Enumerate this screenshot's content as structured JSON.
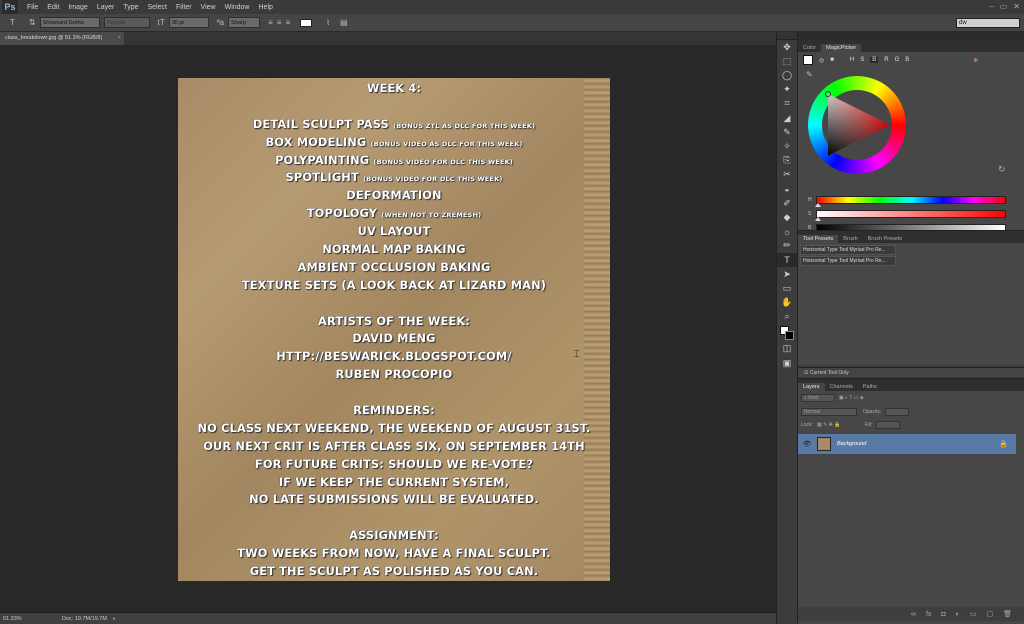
{
  "app": {
    "logo": "Ps"
  },
  "menu": [
    "File",
    "Edit",
    "Image",
    "Layer",
    "Type",
    "Select",
    "Filter",
    "View",
    "Window",
    "Help"
  ],
  "window_controls": [
    "–",
    "▭",
    "✕"
  ],
  "options_bar": {
    "tool_icon": "type-tool-icon",
    "font_family": "Showcard Gothic",
    "font_style": "Regular",
    "font_size": "30 pt",
    "antialias": "Sharp",
    "text_color": "#ffffff",
    "workspace": "dw"
  },
  "document": {
    "tab_title": "class_breakdown.jpg @ 51.3% (RGB/8)",
    "close": "×",
    "lines": [
      {
        "t": "WEEK 4:"
      },
      {
        "t": ""
      },
      {
        "t": "DETAIL  SCULPT PASS ",
        "s": "(BONUS ZTL AS DLC FOR THIS WEEK)"
      },
      {
        "t": "BOX MODELING ",
        "s": "(BONUS VIDEO AS DLC FOR THIS WEEK)"
      },
      {
        "t": "POLYPAINTING ",
        "s": "(BONUS VIDEO FOR DLC THIS WEEK)"
      },
      {
        "t": "SPOTLIGHT ",
        "s": "(BONUS VIDEO FOR DLC THIS WEEK)"
      },
      {
        "t": "DEFORMATION"
      },
      {
        "t": "TOPOLOGY ",
        "s": "(WHEN NOT TO ZREMESH)"
      },
      {
        "t": "UV LAYOUT"
      },
      {
        "t": "NORMAL MAP BAKING"
      },
      {
        "t": "AMBIENT OCCLUSION BAKING"
      },
      {
        "t": "TEXTURE SETS (A LOOK BACK AT LIZARD MAN)"
      },
      {
        "t": ""
      },
      {
        "t": "ARTISTS OF THE WEEK:"
      },
      {
        "t": "DAVID MENG"
      },
      {
        "t": "HTTP://BESWARICK.BLOGSPOT.COM/"
      },
      {
        "t": "RUBEN PROCOPIO"
      },
      {
        "t": ""
      },
      {
        "t": "REMINDERS:"
      },
      {
        "t": "NO CLASS NEXT WEEKEND,  THE WEEKEND OF AUGUST 31ST."
      },
      {
        "t": "OUR NEXT CRIT IS AFTER CLASS SIX, ON SEPTEMBER 14TH"
      },
      {
        "t": "FOR FUTURE CRITS: SHOULD WE RE-VOTE?"
      },
      {
        "t": "IF WE KEEP THE CURRENT SYSTEM,"
      },
      {
        "t": "NO LATE SUBMISSIONS WILL BE EVALUATED."
      },
      {
        "t": ""
      },
      {
        "t": "ASSIGNMENT:"
      },
      {
        "t": "TWO WEEKS FROM NOW, HAVE A FINAL SCULPT."
      },
      {
        "t": "GET THE SCULPT AS POLISHED AS YOU CAN."
      }
    ]
  },
  "status": {
    "zoom": "51.33%",
    "doc": "Doc: 19.7M/19.7M",
    "arrow": "▸"
  },
  "tools": [
    "✥",
    "⬚",
    "◯",
    "✦",
    "⌗",
    "◢",
    "✎",
    "✧",
    "⎘",
    "✂",
    "◒",
    "✐",
    "◆",
    "☼",
    "✏",
    "T",
    "➤",
    "▭",
    "✋",
    "⌕"
  ],
  "color_panel": {
    "tabs": [
      "Color",
      "MagicPicker"
    ],
    "modes": [
      "H",
      "S",
      "B",
      "R",
      "G",
      "B"
    ],
    "selected_mode": "B",
    "slider_labels": [
      "H",
      "S",
      "B"
    ]
  },
  "presets_panel": {
    "tabs": [
      "Tool Presets",
      "Brush",
      "Brush Presets"
    ],
    "items": [
      "Horizontal Type Tool Myriad Pro Re...",
      "Horizontal Type Tool Myriad Pro Re..."
    ],
    "footer": "Current Tool Only"
  },
  "layers_panel": {
    "tabs": [
      "Layers",
      "Channels",
      "Paths"
    ],
    "kind": "Kind",
    "blend_mode": "Normal",
    "opacity_label": "Opacity:",
    "lock_label": "Lock:",
    "fill_label": "Fill:",
    "layer_name": "Background"
  }
}
